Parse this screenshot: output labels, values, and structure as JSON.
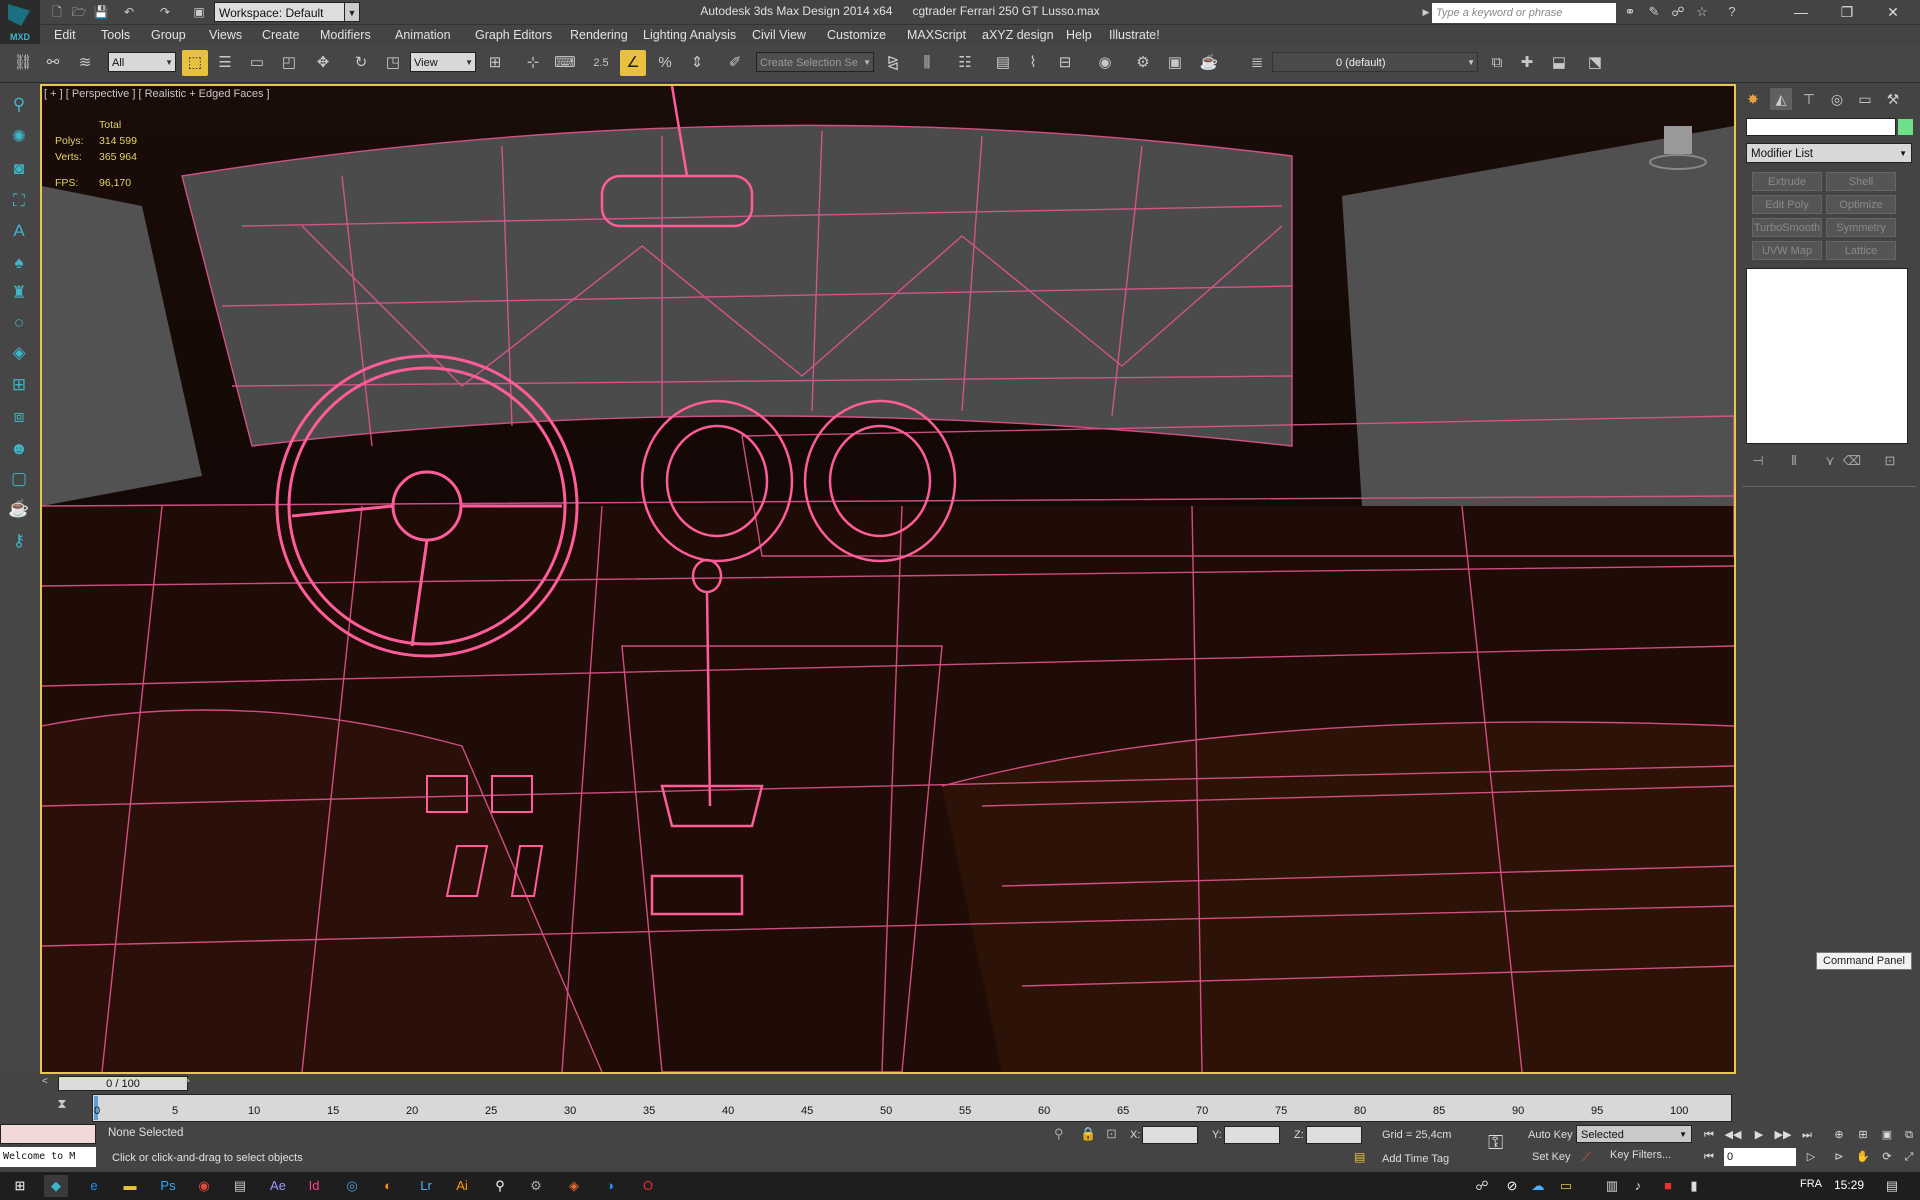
{
  "titlebar": {
    "logo_text": "MXD",
    "workspace": "Workspace: Default",
    "title": "Autodesk 3ds Max Design 2014 x64      cgtrader Ferrari 250 GT Lusso.max",
    "search_placeholder": "Type a keyword or phrase",
    "window_controls": [
      "minimize-icon",
      "maximize-icon",
      "close-icon"
    ]
  },
  "menu": [
    "Edit",
    "Tools",
    "Group",
    "Views",
    "Create",
    "Modifiers",
    "Animation",
    "Graph Editors",
    "Rendering",
    "Lighting Analysis",
    "Civil View",
    "Customize",
    "MAXScript",
    "aXYZ design",
    "Help",
    "Illustrate!"
  ],
  "toolbar": {
    "filter": "All",
    "ref_coord": "View",
    "snap_value": "2.5",
    "selection_set_placeholder": "Create Selection Se",
    "layer": "0 (default)",
    "accent": "#e8c13f"
  },
  "viewport": {
    "label": "[ + ] [ Perspective ] [ Realistic + Edged Faces ]",
    "stats": {
      "total_label": "Total",
      "polys_label": "Polys:",
      "polys_value": "314 599",
      "verts_label": "Verts:",
      "verts_value": "365 964",
      "fps_label": "FPS:",
      "fps_value": "96,170"
    },
    "wire_color": "#e2558f",
    "border_color": "#e8c84a"
  },
  "command_panel": {
    "modifier_list": "Modifier List",
    "buttons": [
      "Extrude",
      "Shell",
      "Edit Poly",
      "Optimize",
      "TurboSmooth",
      "Symmetry",
      "UVW Map",
      "Lattice"
    ],
    "tooltip": "Command Panel"
  },
  "timeline": {
    "slider": "0 / 100",
    "ticks": [
      "0",
      "5",
      "10",
      "15",
      "20",
      "25",
      "30",
      "35",
      "40",
      "45",
      "50",
      "55",
      "60",
      "65",
      "70",
      "75",
      "80",
      "85",
      "90",
      "95",
      "100"
    ]
  },
  "status": {
    "maxscript": "Welcome to M",
    "selection": "None Selected",
    "prompt": "Click or click-and-drag to select objects",
    "x_label": "X:",
    "y_label": "Y:",
    "z_label": "Z:",
    "grid": "Grid = 25,4cm",
    "add_time_tag": "Add Time Tag",
    "auto_key": "Auto Key",
    "set_key": "Set Key",
    "selected": "Selected",
    "key_filters": "Key Filters...",
    "frame": "0"
  },
  "taskbar": {
    "lang": "FRA",
    "time": "15:29"
  }
}
